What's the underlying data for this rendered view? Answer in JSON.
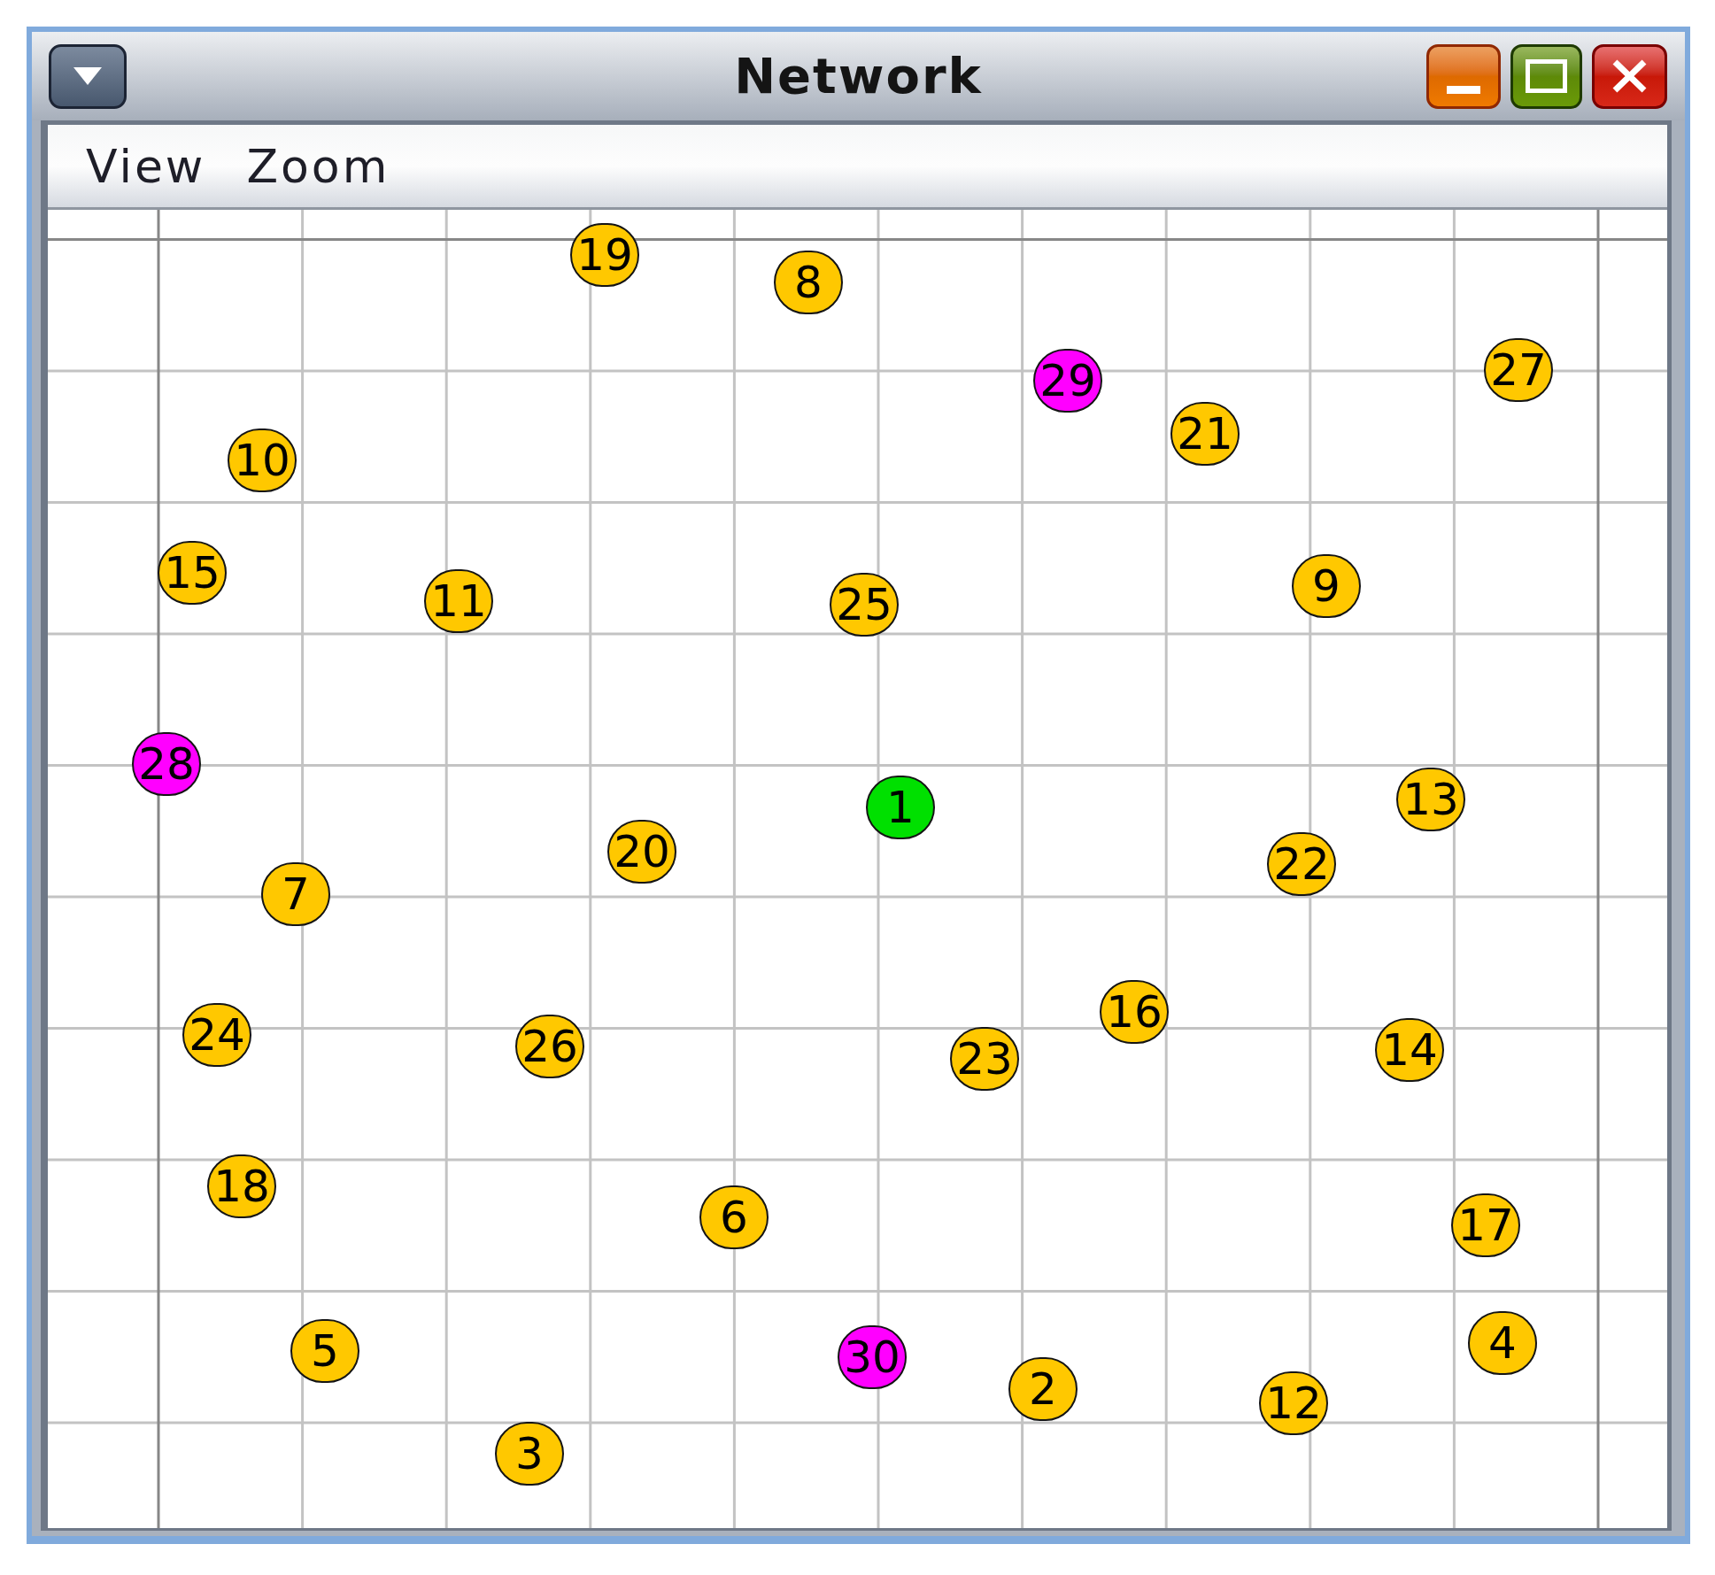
{
  "window": {
    "title": "Network"
  },
  "menu": [
    "View",
    "Zoom"
  ],
  "nodes": [
    {
      "label": "19",
      "color": "#ffc800"
    },
    {
      "label": "8",
      "color": "#ffc800"
    },
    {
      "label": "29",
      "color": "#ff00ff"
    },
    {
      "label": "27",
      "color": "#ffc800"
    },
    {
      "label": "21",
      "color": "#ffc800"
    },
    {
      "label": "10",
      "color": "#ffc800"
    },
    {
      "label": "15",
      "color": "#ffc800"
    },
    {
      "label": "9",
      "color": "#ffc800"
    },
    {
      "label": "11",
      "color": "#ffc800"
    },
    {
      "label": "25",
      "color": "#ffc800"
    },
    {
      "label": "28",
      "color": "#ff00ff"
    },
    {
      "label": "1",
      "color": "#00e000"
    },
    {
      "label": "13",
      "color": "#ffc800"
    },
    {
      "label": "20",
      "color": "#ffc800"
    },
    {
      "label": "22",
      "color": "#ffc800"
    },
    {
      "label": "7",
      "color": "#ffc800"
    },
    {
      "label": "16",
      "color": "#ffc800"
    },
    {
      "label": "24",
      "color": "#ffc800"
    },
    {
      "label": "26",
      "color": "#ffc800"
    },
    {
      "label": "23",
      "color": "#ffc800"
    },
    {
      "label": "14",
      "color": "#ffc800"
    },
    {
      "label": "18",
      "color": "#ffc800"
    },
    {
      "label": "6",
      "color": "#ffc800"
    },
    {
      "label": "17",
      "color": "#ffc800"
    },
    {
      "label": "5",
      "color": "#ffc800"
    },
    {
      "label": "30",
      "color": "#ff00ff"
    },
    {
      "label": "4",
      "color": "#ffc800"
    },
    {
      "label": "2",
      "color": "#ffc800"
    },
    {
      "label": "12",
      "color": "#ffc800"
    },
    {
      "label": "3",
      "color": "#ffc800"
    }
  ]
}
